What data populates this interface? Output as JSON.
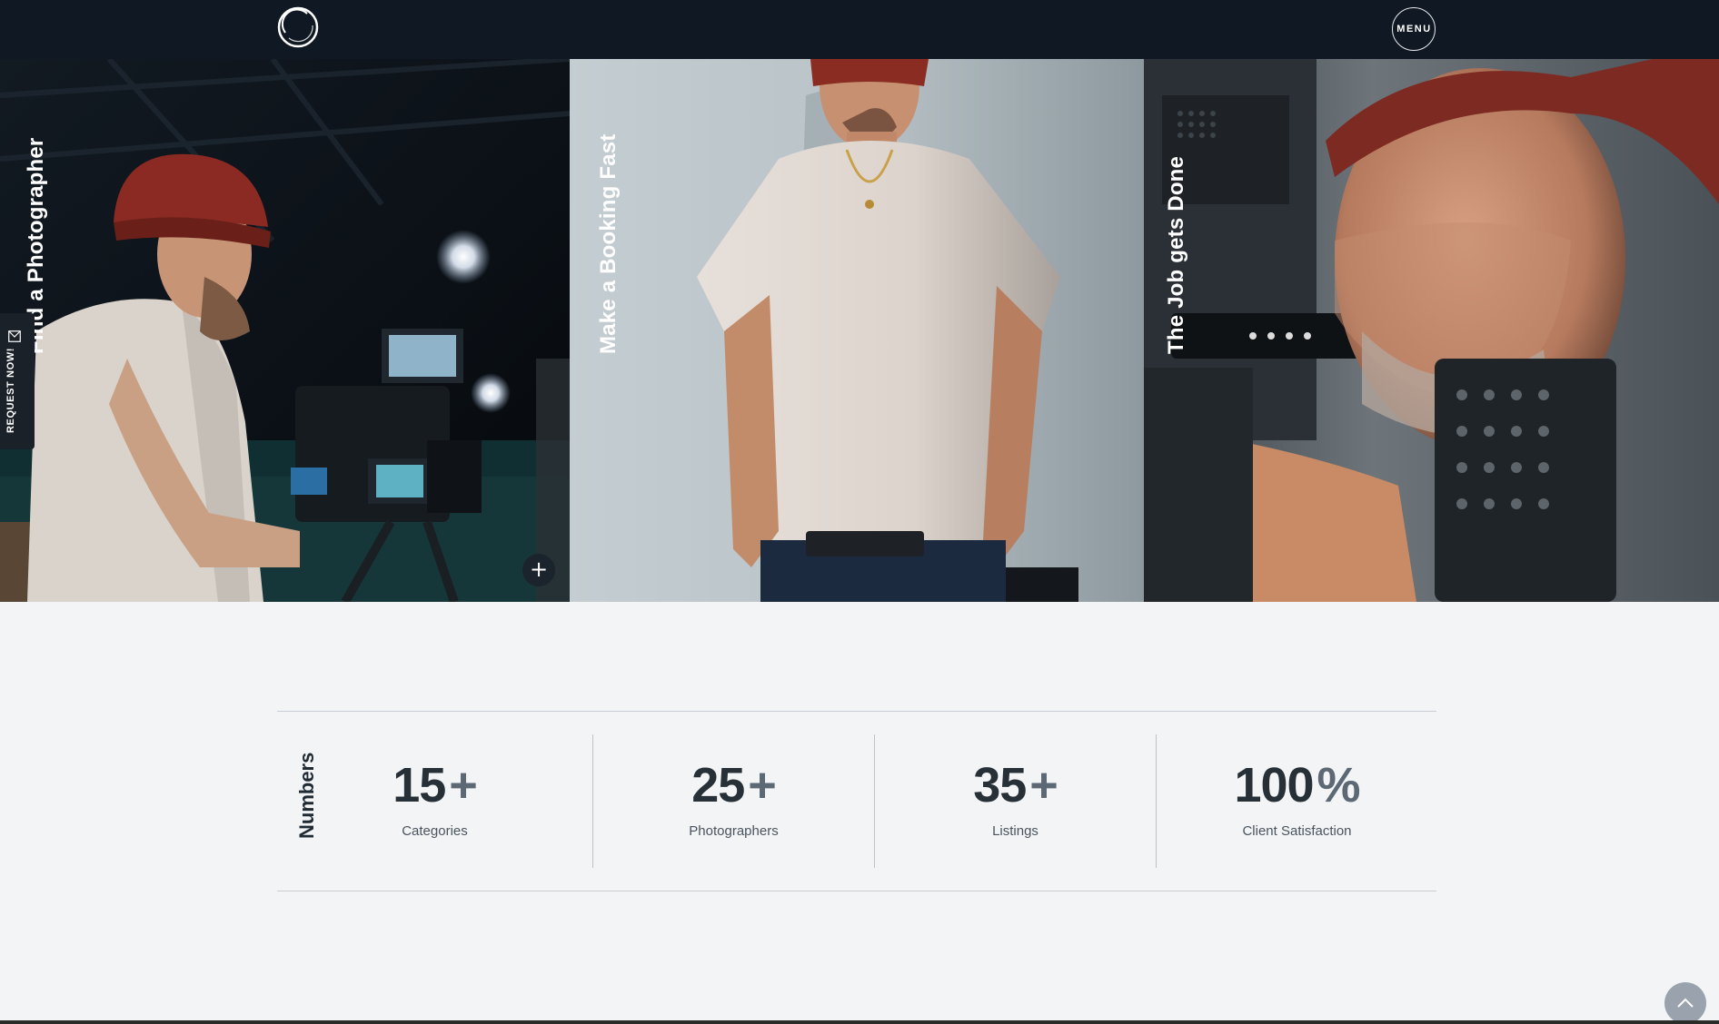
{
  "header": {
    "menu_label": "MENU"
  },
  "hero": {
    "panels": [
      {
        "title": "Find a Photographer"
      },
      {
        "title": "Make a Booking Fast"
      },
      {
        "title": "The Job gets Done"
      }
    ],
    "plus_glyph": "+"
  },
  "request_tab": {
    "label": "REQUEST NOW!"
  },
  "numbers": {
    "label": "Numbers",
    "stats": [
      {
        "value": "15",
        "suffix": "+",
        "caption": "Categories"
      },
      {
        "value": "25",
        "suffix": "+",
        "caption": "Photographers"
      },
      {
        "value": "35",
        "suffix": "+",
        "caption": "Listings"
      },
      {
        "value": "100",
        "suffix": "%",
        "caption": "Client Satisfaction"
      }
    ]
  },
  "icons": {
    "logo": "ring-logo-icon",
    "request": "mail-icon",
    "scroll_top": "chevron-up-icon",
    "plus": "plus-icon"
  },
  "colors": {
    "header_bg": "#101923",
    "page_bg": "#f3f4f6",
    "text_dark": "#272f37",
    "suffix": "#5c6873"
  }
}
